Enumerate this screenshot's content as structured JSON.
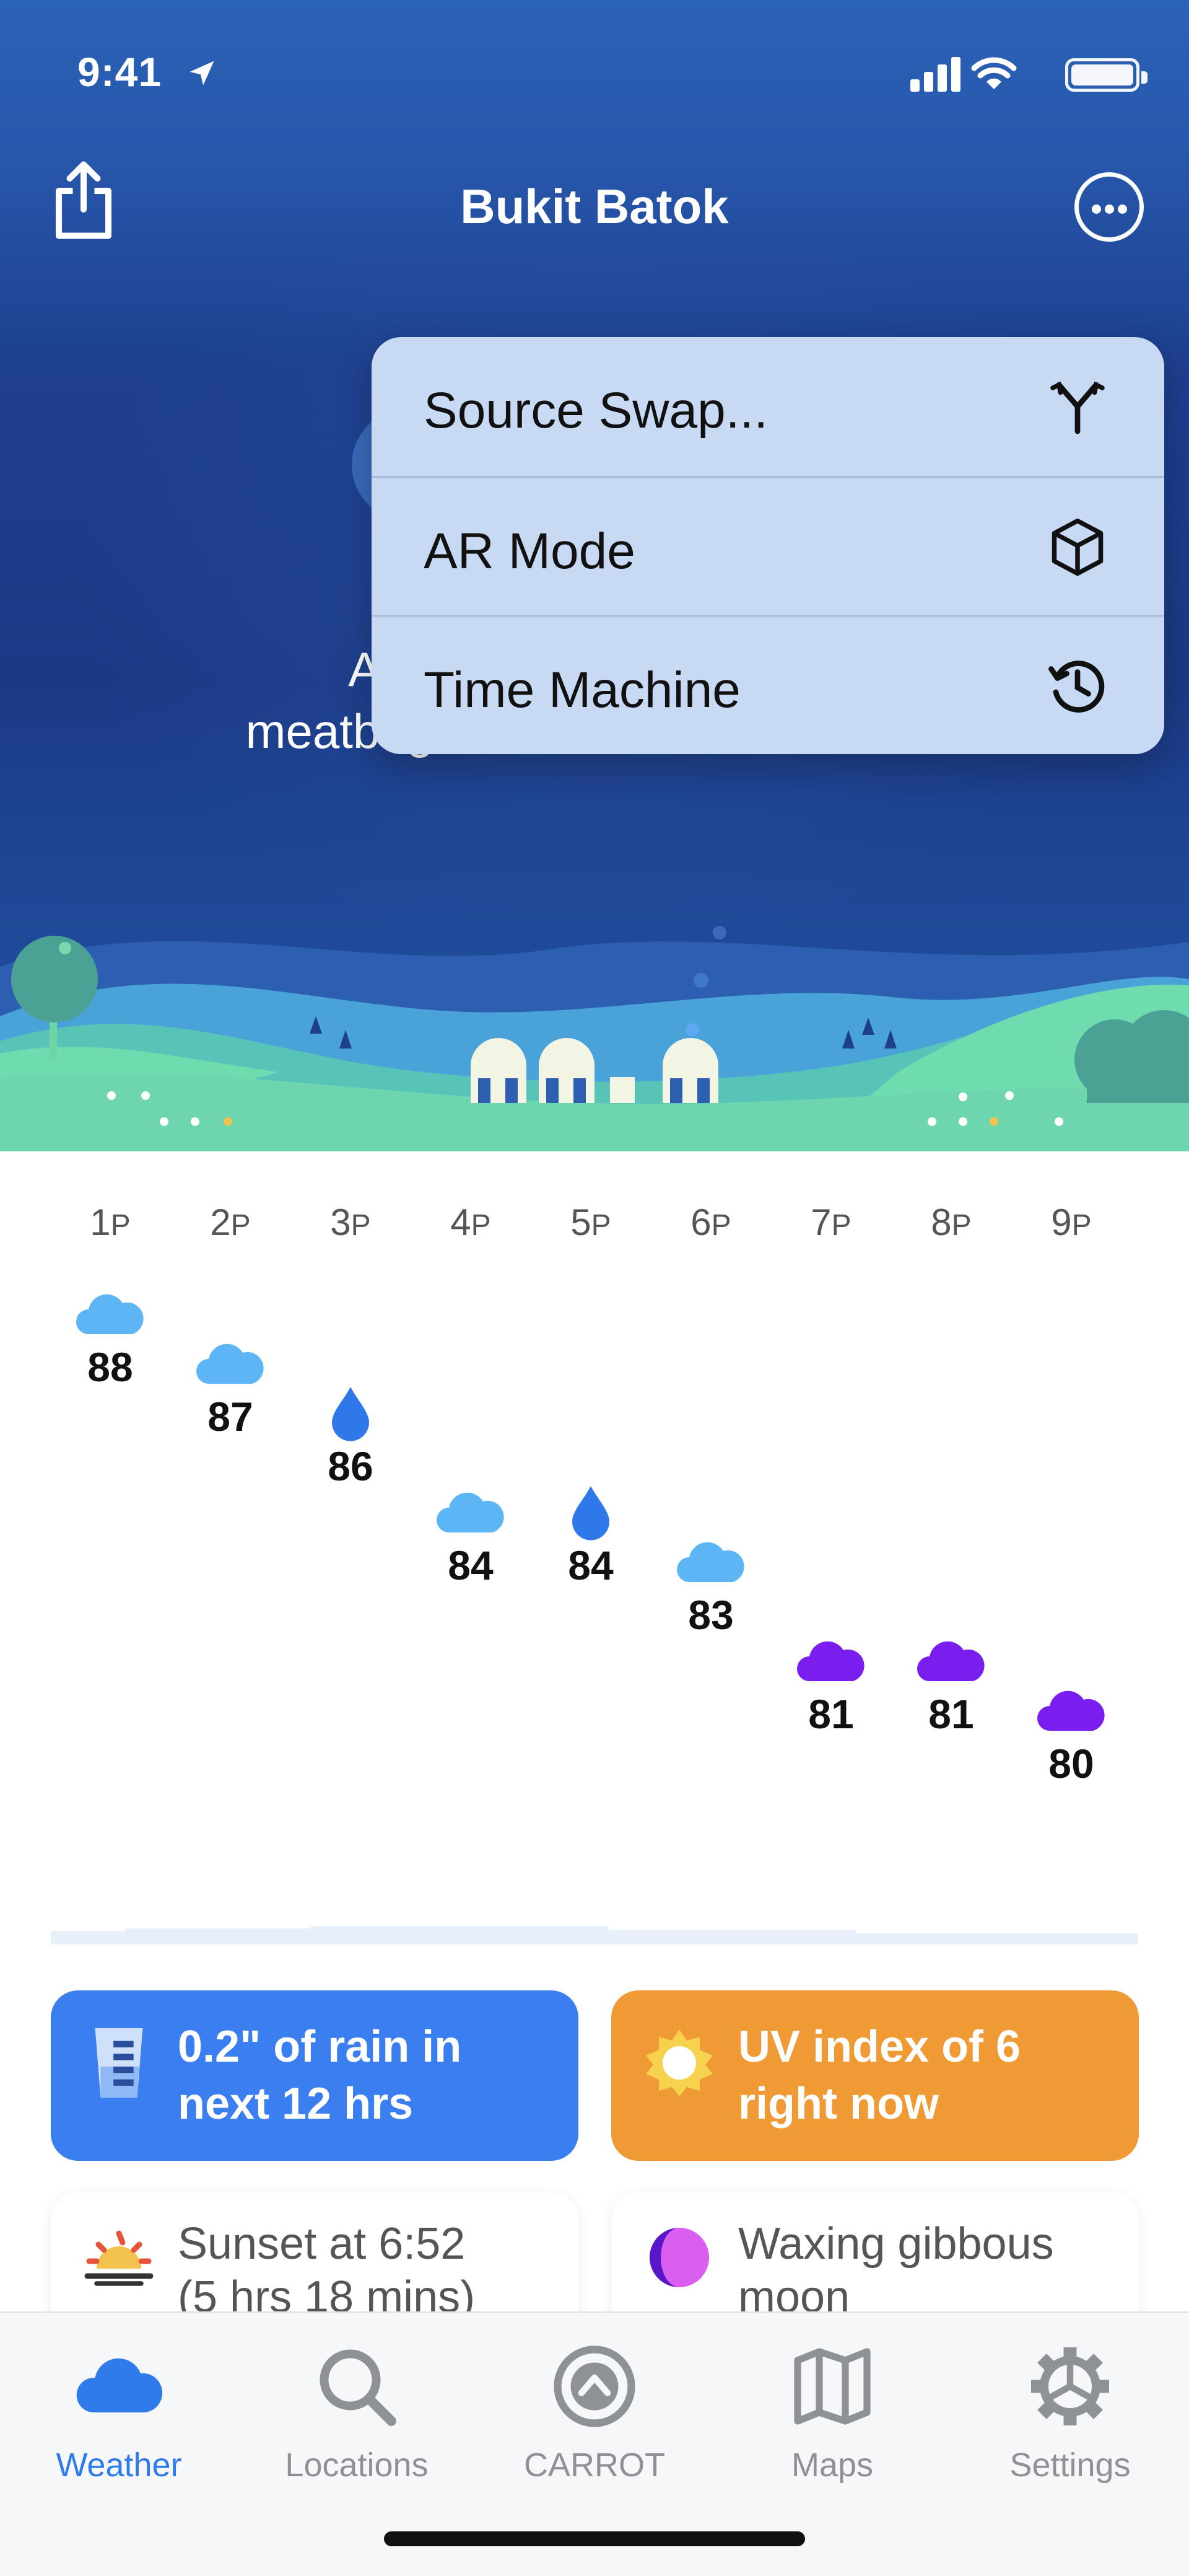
{
  "status_bar": {
    "time": "9:41"
  },
  "header": {
    "title": "Bukit Batok"
  },
  "hero": {
    "message_line1": "Are yo",
    "message_line2": "meatbag?"
  },
  "menu": {
    "items": [
      {
        "label": "Source Swap...",
        "icon": "fork-icon"
      },
      {
        "label": "AR Mode",
        "icon": "cube-icon"
      },
      {
        "label": "Time Machine",
        "icon": "history-clock-icon"
      }
    ]
  },
  "hourly": [
    {
      "hour": "1",
      "suffix": "P",
      "temp": "88",
      "icon": "cloud",
      "color": "#5cb6f5"
    },
    {
      "hour": "2",
      "suffix": "P",
      "temp": "87",
      "icon": "cloud",
      "color": "#5cb6f5"
    },
    {
      "hour": "3",
      "suffix": "P",
      "temp": "86",
      "icon": "drop",
      "color": "#2f78ea"
    },
    {
      "hour": "4",
      "suffix": "P",
      "temp": "84",
      "icon": "cloud",
      "color": "#5cb6f5"
    },
    {
      "hour": "5",
      "suffix": "P",
      "temp": "84",
      "icon": "drop",
      "color": "#2f78ea"
    },
    {
      "hour": "6",
      "suffix": "P",
      "temp": "83",
      "icon": "cloud",
      "color": "#5cb6f5"
    },
    {
      "hour": "7",
      "suffix": "P",
      "temp": "81",
      "icon": "cloud",
      "color": "#7a1ef0"
    },
    {
      "hour": "8",
      "suffix": "P",
      "temp": "81",
      "icon": "cloud",
      "color": "#7a1ef0"
    },
    {
      "hour": "9",
      "suffix": "P",
      "temp": "80",
      "icon": "cloud",
      "color": "#7a1ef0"
    }
  ],
  "cards": {
    "rain": {
      "line1": "0.2\" of rain in",
      "line2": "next 12 hrs"
    },
    "uv": {
      "line1": "UV index of 6",
      "line2": "right now"
    },
    "sunset": {
      "line1": "Sunset at 6:52",
      "line2": "(5 hrs 18 mins)"
    },
    "moon": {
      "line1": "Waxing gibbous",
      "line2": "moon"
    }
  },
  "tabs": [
    {
      "label": "Weather",
      "icon": "cloud-icon",
      "active": true
    },
    {
      "label": "Locations",
      "icon": "search-icon",
      "active": false
    },
    {
      "label": "CARROT",
      "icon": "carrot-logo-icon",
      "active": false
    },
    {
      "label": "Maps",
      "icon": "map-icon",
      "active": false
    },
    {
      "label": "Settings",
      "icon": "gear-icon",
      "active": false
    }
  ],
  "colors": {
    "accent": "#2f7bea",
    "rain_card": "#3b7ef0",
    "uv_card": "#ef9a35",
    "menu_bg": "#c8d9f3"
  }
}
